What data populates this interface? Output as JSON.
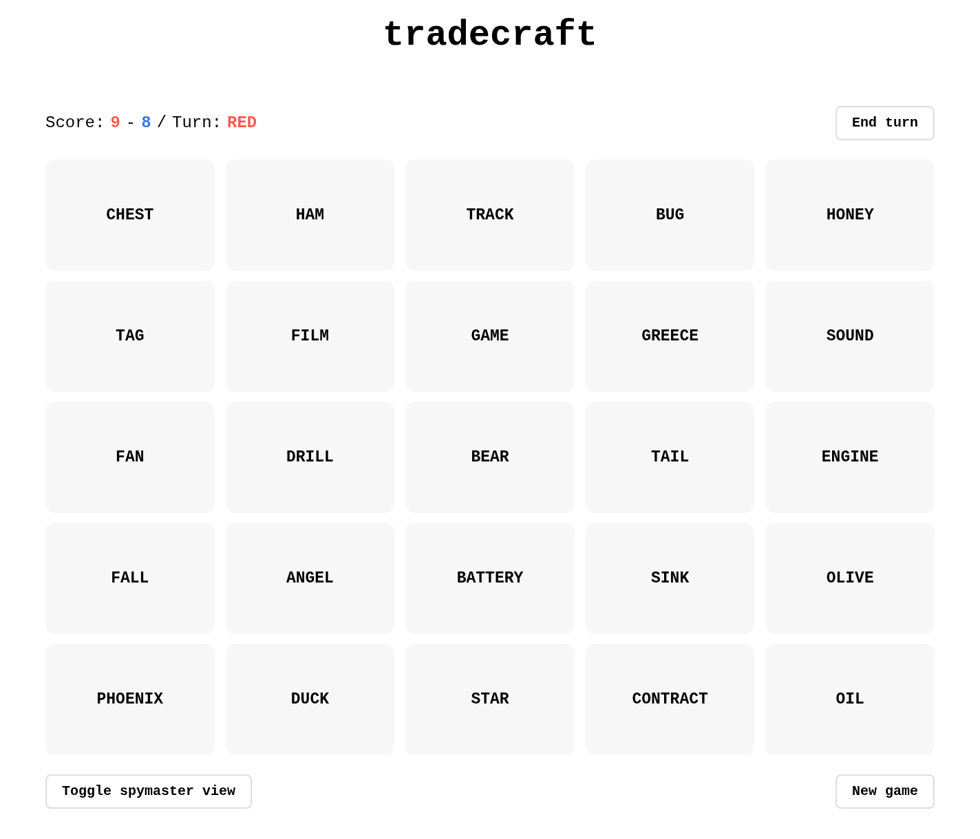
{
  "title": "tradecraft",
  "score": {
    "label": "Score:",
    "separator": "-",
    "teams": [
      {
        "value": "9",
        "color": "#f85c50"
      },
      {
        "value": "8",
        "color": "#3a78dc"
      }
    ]
  },
  "turn": {
    "divider": "/",
    "label": "Turn:",
    "value": "RED",
    "color": "#f85c50"
  },
  "end_turn_button": "End turn",
  "cards": [
    "CHEST",
    "HAM",
    "TRACK",
    "BUG",
    "HONEY",
    "TAG",
    "FILM",
    "GAME",
    "GREECE",
    "SOUND",
    "FAN",
    "DRILL",
    "BEAR",
    "TAIL",
    "ENGINE",
    "FALL",
    "ANGEL",
    "BATTERY",
    "SINK",
    "OLIVE",
    "PHOENIX",
    "DUCK",
    "STAR",
    "CONTRACT",
    "OIL"
  ],
  "footer_buttons": [
    "Toggle spymaster view",
    "New game"
  ]
}
